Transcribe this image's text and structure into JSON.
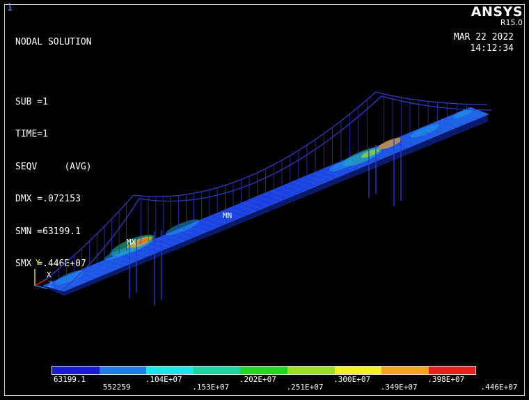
{
  "window_number": "1",
  "result": {
    "title": "NODAL SOLUTION",
    "sub": "SUB =1",
    "time": "TIME=1",
    "quantity": "SEQV     (AVG)",
    "dmx": "DMX =.072153",
    "smn": "SMN =63199.1",
    "smx": "SMX =.446E+07"
  },
  "brand": {
    "name": "ANSYS",
    "version": "R15.0"
  },
  "timestamp": {
    "date": "MAR 22 2022",
    "time": "14:12:34"
  },
  "markers": {
    "min": "MN",
    "max": "MX"
  },
  "triad": {
    "y": "Y",
    "x": "X",
    "z": "Z"
  },
  "legend": {
    "colors": [
      "#1a1ad6",
      "#1e7ce6",
      "#19e6e6",
      "#19d6a0",
      "#22d622",
      "#9ade22",
      "#f2f21e",
      "#f2a21e",
      "#e61e1e"
    ],
    "labels_top": [
      "63199.1",
      ".104E+07",
      ".202E+07",
      ".300E+07",
      ".398E+07"
    ],
    "labels_bottom": [
      "552259",
      ".153E+07",
      ".251E+07",
      ".349E+07",
      ".446E+07"
    ]
  }
}
